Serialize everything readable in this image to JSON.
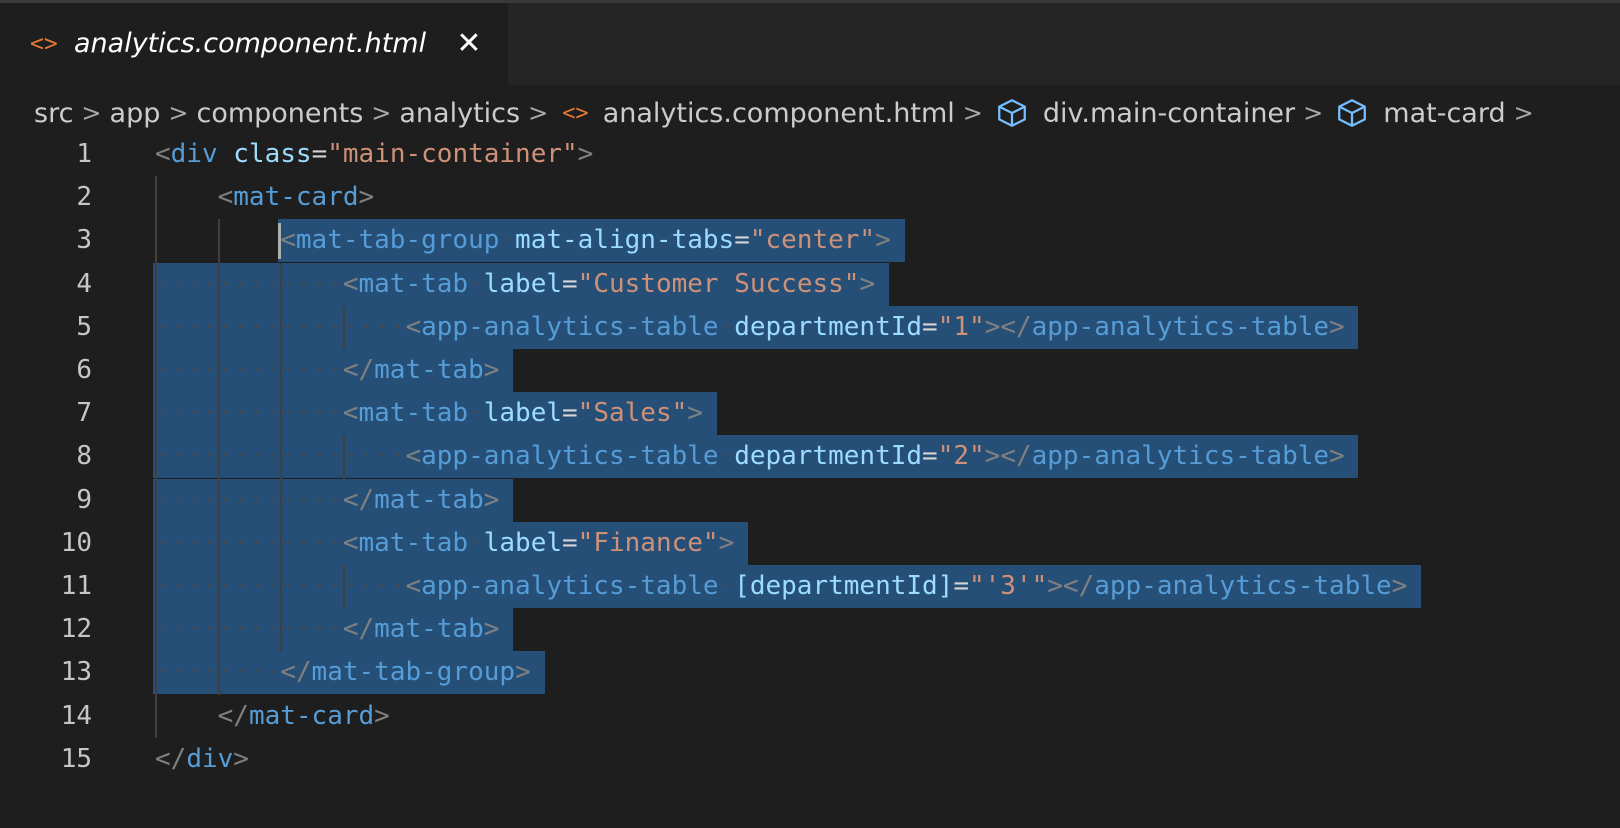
{
  "tab": {
    "icon": "html-file-icon",
    "title": "analytics.component.html",
    "close_glyph": "✕"
  },
  "breadcrumb": {
    "items": [
      "src",
      "app",
      "components",
      "analytics",
      "analytics.component.html",
      "div.main-container",
      "mat-card"
    ],
    "separator": ">"
  },
  "editor": {
    "line_numbers": [
      "1",
      "2",
      "3",
      "4",
      "5",
      "6",
      "7",
      "8",
      "9",
      "10",
      "11",
      "12",
      "13",
      "14",
      "15"
    ],
    "lines": [
      {
        "indent": "",
        "tokens": [
          [
            "p",
            "<"
          ],
          [
            "t",
            "div"
          ],
          [
            "e",
            " "
          ],
          [
            "a",
            "class"
          ],
          [
            "e",
            "="
          ],
          [
            "s",
            "\"main-container\""
          ],
          [
            "p",
            ">"
          ]
        ]
      },
      {
        "indent": "    ",
        "tokens": [
          [
            "p",
            "<"
          ],
          [
            "t",
            "mat-card"
          ],
          [
            "p",
            ">"
          ]
        ]
      },
      {
        "indent": "        ",
        "tokens": [
          [
            "p",
            "<"
          ],
          [
            "t",
            "mat-tab-group"
          ],
          [
            "e",
            " "
          ],
          [
            "a",
            "mat-align-tabs"
          ],
          [
            "e",
            "="
          ],
          [
            "s",
            "\"center\""
          ],
          [
            "p",
            ">"
          ]
        ]
      },
      {
        "indent": "            ",
        "tokens": [
          [
            "p",
            "<"
          ],
          [
            "t",
            "mat-tab"
          ],
          [
            "e",
            " "
          ],
          [
            "a",
            "label"
          ],
          [
            "e",
            "="
          ],
          [
            "s",
            "\"Customer Success\""
          ],
          [
            "p",
            ">"
          ]
        ]
      },
      {
        "indent": "                ",
        "tokens": [
          [
            "p",
            "<"
          ],
          [
            "t",
            "app-analytics-table"
          ],
          [
            "e",
            " "
          ],
          [
            "a",
            "departmentId"
          ],
          [
            "e",
            "="
          ],
          [
            "s",
            "\"1\""
          ],
          [
            "p",
            "></"
          ],
          [
            "t",
            "app-analytics-table"
          ],
          [
            "p",
            ">"
          ]
        ]
      },
      {
        "indent": "            ",
        "tokens": [
          [
            "p",
            "</"
          ],
          [
            "t",
            "mat-tab"
          ],
          [
            "p",
            ">"
          ]
        ]
      },
      {
        "indent": "            ",
        "tokens": [
          [
            "p",
            "<"
          ],
          [
            "t",
            "mat-tab"
          ],
          [
            "e",
            " "
          ],
          [
            "a",
            "label"
          ],
          [
            "e",
            "="
          ],
          [
            "s",
            "\"Sales\""
          ],
          [
            "p",
            ">"
          ]
        ]
      },
      {
        "indent": "                ",
        "tokens": [
          [
            "p",
            "<"
          ],
          [
            "t",
            "app-analytics-table"
          ],
          [
            "e",
            " "
          ],
          [
            "a",
            "departmentId"
          ],
          [
            "e",
            "="
          ],
          [
            "s",
            "\"2\""
          ],
          [
            "p",
            "></"
          ],
          [
            "t",
            "app-analytics-table"
          ],
          [
            "p",
            ">"
          ]
        ]
      },
      {
        "indent": "            ",
        "tokens": [
          [
            "p",
            "</"
          ],
          [
            "t",
            "mat-tab"
          ],
          [
            "p",
            ">"
          ]
        ]
      },
      {
        "indent": "            ",
        "tokens": [
          [
            "p",
            "<"
          ],
          [
            "t",
            "mat-tab"
          ],
          [
            "e",
            " "
          ],
          [
            "a",
            "label"
          ],
          [
            "e",
            "="
          ],
          [
            "s",
            "\"Finance\""
          ],
          [
            "p",
            ">"
          ]
        ]
      },
      {
        "indent": "                ",
        "tokens": [
          [
            "p",
            "<"
          ],
          [
            "t",
            "app-analytics-table"
          ],
          [
            "e",
            " "
          ],
          [
            "a",
            "[departmentId]"
          ],
          [
            "e",
            "="
          ],
          [
            "s",
            "\"'3'\""
          ],
          [
            "p",
            "></"
          ],
          [
            "t",
            "app-analytics-table"
          ],
          [
            "p",
            ">"
          ]
        ]
      },
      {
        "indent": "            ",
        "tokens": [
          [
            "p",
            "</"
          ],
          [
            "t",
            "mat-tab"
          ],
          [
            "p",
            ">"
          ]
        ]
      },
      {
        "indent": "        ",
        "tokens": [
          [
            "p",
            "</"
          ],
          [
            "t",
            "mat-tab-group"
          ],
          [
            "p",
            ">"
          ]
        ]
      },
      {
        "indent": "    ",
        "tokens": [
          [
            "p",
            "</"
          ],
          [
            "t",
            "mat-card"
          ],
          [
            "p",
            ">"
          ]
        ]
      },
      {
        "indent": "",
        "tokens": [
          [
            "p",
            "</"
          ],
          [
            "t",
            "div"
          ],
          [
            "p",
            ">"
          ]
        ]
      }
    ],
    "selection": {
      "from_line": 3,
      "to_line": 13
    }
  },
  "colors": {
    "background": "#1e1e1e",
    "selection": "#264f78",
    "tag": "#569cd6",
    "attribute": "#9cdcfe",
    "string": "#ce9178",
    "punctuation": "#808080",
    "html_icon": "#e37933",
    "symbol_icon": "#75beff"
  }
}
